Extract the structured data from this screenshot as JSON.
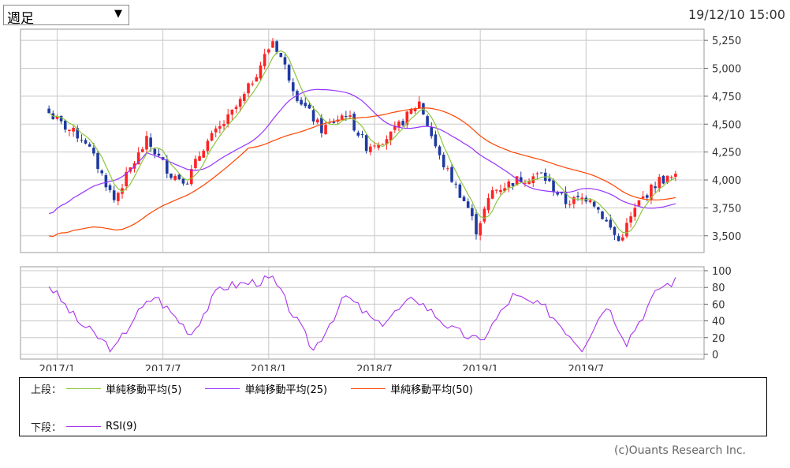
{
  "controls": {
    "period_value": "週足",
    "dropdown_arrow": "▼",
    "dropdown_icon": "chevron-down-icon"
  },
  "timestamp": "19/12/10 15:00",
  "copyright": "(c)Ouants Research Inc.",
  "legend": {
    "upper_label": "上段：",
    "lower_label": "下段：",
    "sma5": {
      "label": "単純移動平均(5)",
      "color": "#8cc63f"
    },
    "sma25": {
      "label": "単純移動平均(25)",
      "color": "#9933ff"
    },
    "sma50": {
      "label": "単純移動平均(50)",
      "color": "#ff4400"
    },
    "rsi": {
      "label": "RSI(9)",
      "color": "#aa33ee"
    }
  },
  "chart_data": {
    "type": "candlestick",
    "x_tick_labels": [
      "2017/1",
      "2017/7",
      "2018/1",
      "2018/7",
      "2019/1",
      "2019/7"
    ],
    "price_axis": {
      "ylim": [
        3350,
        5350
      ],
      "ticks": [
        3500,
        3750,
        4000,
        4250,
        4500,
        4750,
        5000,
        5250
      ],
      "tick_labels": [
        "3,500",
        "3,750",
        "4,000",
        "4,250",
        "4,500",
        "4,750",
        "5,000",
        "5,250"
      ]
    },
    "rsi_axis": {
      "ylim": [
        0,
        100
      ],
      "ticks": [
        0,
        20,
        40,
        60,
        80,
        100
      ],
      "tick_labels": [
        "0",
        "20",
        "40",
        "60",
        "80",
        "100"
      ]
    },
    "grid": true,
    "up_color": "#ff2222",
    "down_color": "#1f3aa0",
    "close_anchors": [
      {
        "date": "2016/12/23",
        "close": 4600
      },
      {
        "date": "2017/1/13",
        "close": 4500
      },
      {
        "date": "2017/2/24",
        "close": 4350
      },
      {
        "date": "2017/4/14",
        "close": 3820
      },
      {
        "date": "2017/5/12",
        "close": 4100
      },
      {
        "date": "2017/6/9",
        "close": 4350
      },
      {
        "date": "2017/7/21",
        "close": 4050
      },
      {
        "date": "2017/8/18",
        "close": 4000
      },
      {
        "date": "2017/9/15",
        "close": 4300
      },
      {
        "date": "2017/10/27",
        "close": 4550
      },
      {
        "date": "2017/11/24",
        "close": 4750
      },
      {
        "date": "2018/1/12",
        "close": 5250
      },
      {
        "date": "2018/1/26",
        "close": 5100
      },
      {
        "date": "2018/2/23",
        "close": 4750
      },
      {
        "date": "2018/4/6",
        "close": 4450
      },
      {
        "date": "2018/5/18",
        "close": 4600
      },
      {
        "date": "2018/6/22",
        "close": 4300
      },
      {
        "date": "2018/8/3",
        "close": 4400
      },
      {
        "date": "2018/9/21",
        "close": 4700
      },
      {
        "date": "2018/10/26",
        "close": 4200
      },
      {
        "date": "2018/12/14",
        "close": 3750
      },
      {
        "date": "2018/12/28",
        "close": 3550
      },
      {
        "date": "2019/1/25",
        "close": 3900
      },
      {
        "date": "2019/3/8",
        "close": 4000
      },
      {
        "date": "2019/4/19",
        "close": 4050
      },
      {
        "date": "2019/5/31",
        "close": 3800
      },
      {
        "date": "2019/7/12",
        "close": 3850
      },
      {
        "date": "2019/8/30",
        "close": 3450
      },
      {
        "date": "2019/10/4",
        "close": 3800
      },
      {
        "date": "2019/11/8",
        "close": 4000
      },
      {
        "date": "2019/12/6",
        "close": 4020
      }
    ],
    "rsi_anchors": [
      {
        "date": "2016/12/23",
        "value": 83
      },
      {
        "date": "2017/2/10",
        "value": 40
      },
      {
        "date": "2017/4/14",
        "value": 5
      },
      {
        "date": "2017/5/19",
        "value": 45
      },
      {
        "date": "2017/6/23",
        "value": 70
      },
      {
        "date": "2017/8/25",
        "value": 25
      },
      {
        "date": "2017/10/13",
        "value": 80
      },
      {
        "date": "2018/1/12",
        "value": 90
      },
      {
        "date": "2018/3/23",
        "value": 5
      },
      {
        "date": "2018/5/18",
        "value": 70
      },
      {
        "date": "2018/7/13",
        "value": 35
      },
      {
        "date": "2018/9/14",
        "value": 68
      },
      {
        "date": "2018/11/16",
        "value": 30
      },
      {
        "date": "2019/1/4",
        "value": 15
      },
      {
        "date": "2019/3/1",
        "value": 70
      },
      {
        "date": "2019/4/26",
        "value": 55
      },
      {
        "date": "2019/6/28",
        "value": 8
      },
      {
        "date": "2019/8/9",
        "value": 60
      },
      {
        "date": "2019/9/13",
        "value": 15
      },
      {
        "date": "2019/11/8",
        "value": 80
      },
      {
        "date": "2019/12/6",
        "value": 88
      }
    ]
  }
}
